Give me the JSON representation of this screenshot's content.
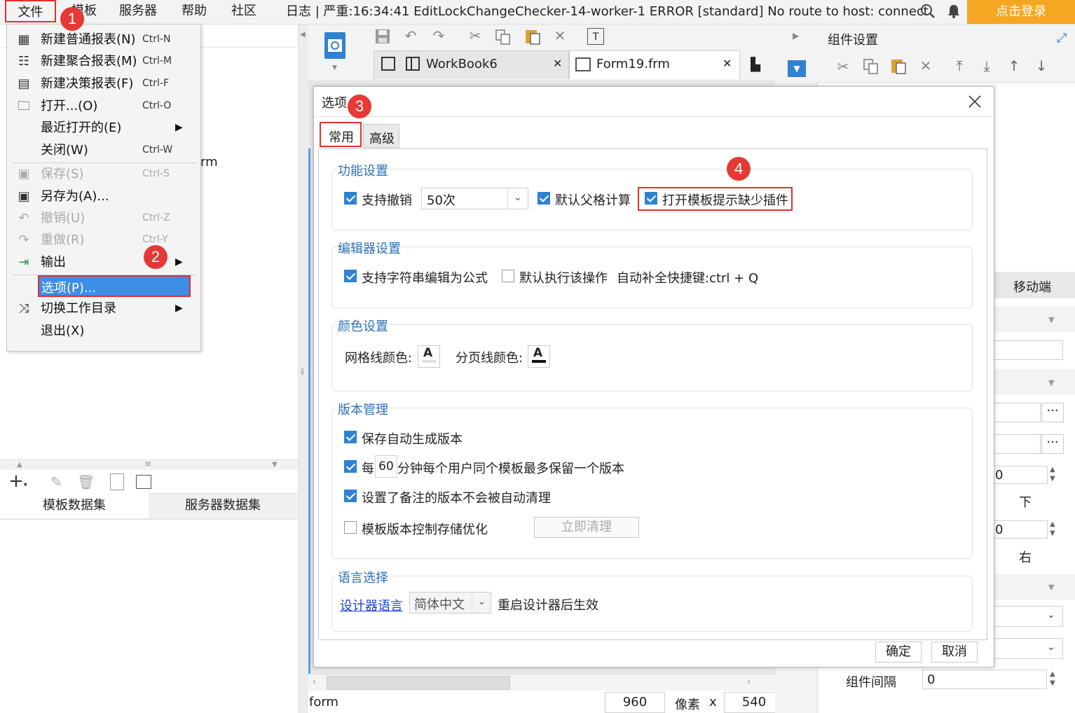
{
  "menubar": {
    "items": [
      "文件",
      "模板",
      "服务器",
      "帮助",
      "社区"
    ],
    "log": "日志 | 严重:16:34:41 EditLockChangeChecker-14-worker-1 ERROR [standard] No route to host: connect",
    "login": "点击登录"
  },
  "file_menu": {
    "items": [
      {
        "label": "新建普通报表(N)",
        "shortcut": "Ctrl-N"
      },
      {
        "label": "新建聚合报表(M)",
        "shortcut": "Ctrl-M"
      },
      {
        "label": "新建决策报表(F)",
        "shortcut": "Ctrl-F"
      },
      {
        "label": "打开...(O)",
        "shortcut": "Ctrl-O"
      },
      {
        "label": "最近打开的(E)",
        "shortcut": ""
      },
      {
        "label": "关闭(W)",
        "shortcut": "Ctrl-W"
      },
      {
        "label": "保存(S)",
        "shortcut": "Ctrl-S"
      },
      {
        "label": "另存为(A)...",
        "shortcut": ""
      },
      {
        "label": "撤销(U)",
        "shortcut": "Ctrl-Z"
      },
      {
        "label": "重做(R)",
        "shortcut": "Ctrl-Y"
      },
      {
        "label": "输出",
        "shortcut": ""
      },
      {
        "label": "选项(P)...",
        "shortcut": ""
      },
      {
        "label": "切换工作目录",
        "shortcut": ""
      },
      {
        "label": "退出(X)",
        "shortcut": ""
      }
    ]
  },
  "badges": [
    "1",
    "2",
    "3",
    "4"
  ],
  "left_panel": {
    "partial_text": "rm",
    "tabs": [
      "模板数据集",
      "服务器数据集"
    ]
  },
  "tabs": {
    "workbook": "WorkBook6",
    "form": "Form19.frm"
  },
  "right_panel": {
    "title": "组件设置",
    "mobile_tab": "移动端",
    "labels": [
      "下",
      "右"
    ],
    "spin_values": [
      "0",
      "0"
    ],
    "gap_label": "组件间隔",
    "gap_value": "0"
  },
  "status": {
    "form": "form",
    "width": "960",
    "unit": "像素",
    "x": "x",
    "height": "540"
  },
  "dialog": {
    "title": "选项",
    "tabs": [
      "常用",
      "高级"
    ],
    "func": {
      "title": "功能设置",
      "undo": "支持撤销",
      "undo_count": "50次",
      "parent_calc": "默认父格计算",
      "plugin_hint": "打开模板提示缺少插件"
    },
    "editor": {
      "title": "编辑器设置",
      "formula": "支持字符串编辑为公式",
      "default_exec": "默认执行该操作",
      "autocomplete": "自动补全快捷键:ctrl + Q"
    },
    "color": {
      "title": "颜色设置",
      "grid": "网格线颜色:",
      "page": "分页线颜色:",
      "glyph": "A"
    },
    "version": {
      "title": "版本管理",
      "auto_version": "保存自动生成版本",
      "every": "每",
      "minutes": "60",
      "per_user": "分钟每个用户同个模板最多保留一个版本",
      "noted": "设置了备注的版本不会被自动清理",
      "optimize": "模板版本控制存储优化",
      "clean_now": "立即清理"
    },
    "lang": {
      "title": "语言选择",
      "designer_lang": "设计器语言",
      "value": "简体中文",
      "restart": "重启设计器后生效"
    },
    "ok": "确定",
    "cancel": "取消"
  },
  "colors": {
    "accent": "#2f82d2",
    "highlight": "#3d8ee6",
    "red": "#e03030",
    "login": "#f5a623"
  }
}
